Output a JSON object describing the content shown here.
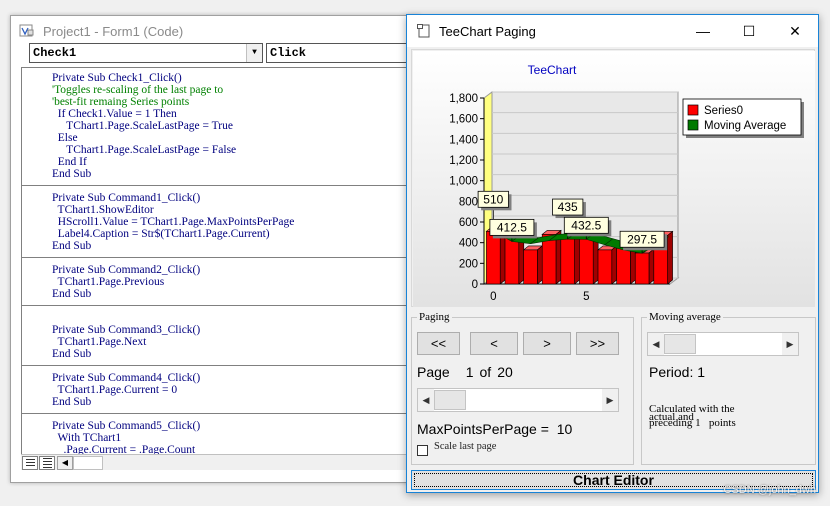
{
  "code_window": {
    "title": "Project1 - Form1 (Code)",
    "object_combo": "Check1",
    "procedure_combo": "Click",
    "lines": [
      {
        "text": "Private Sub Check1_Click()",
        "kind": "code"
      },
      {
        "text": "'Toggles re-scaling of the last page to",
        "kind": "comment"
      },
      {
        "text": "'best-fit remaing Series points",
        "kind": "comment"
      },
      {
        "text": "  If Check1.Value = 1 Then",
        "kind": "code"
      },
      {
        "text": "     TChart1.Page.ScaleLastPage = True",
        "kind": "code"
      },
      {
        "text": "  Else",
        "kind": "code"
      },
      {
        "text": "     TChart1.Page.ScaleLastPage = False",
        "kind": "code"
      },
      {
        "text": "  End If",
        "kind": "code"
      },
      {
        "text": "End Sub",
        "kind": "code"
      },
      {
        "text": "",
        "kind": "sep"
      },
      {
        "text": "Private Sub Command1_Click()",
        "kind": "code"
      },
      {
        "text": "  TChart1.ShowEditor",
        "kind": "code"
      },
      {
        "text": "  HScroll1.Value = TChart1.Page.MaxPointsPerPage",
        "kind": "code"
      },
      {
        "text": "  Label4.Caption = Str$(TChart1.Page.Current)",
        "kind": "code"
      },
      {
        "text": "End Sub",
        "kind": "code"
      },
      {
        "text": "",
        "kind": "sep"
      },
      {
        "text": "Private Sub Command2_Click()",
        "kind": "code"
      },
      {
        "text": "  TChart1.Page.Previous",
        "kind": "code"
      },
      {
        "text": "End Sub",
        "kind": "code"
      },
      {
        "text": "",
        "kind": "sep"
      },
      {
        "text": "",
        "kind": "blank"
      },
      {
        "text": "Private Sub Command3_Click()",
        "kind": "code"
      },
      {
        "text": "  TChart1.Page.Next",
        "kind": "code"
      },
      {
        "text": "End Sub",
        "kind": "code"
      },
      {
        "text": "",
        "kind": "sep"
      },
      {
        "text": "Private Sub Command4_Click()",
        "kind": "code"
      },
      {
        "text": "  TChart1.Page.Current = 0",
        "kind": "code"
      },
      {
        "text": "End Sub",
        "kind": "code"
      },
      {
        "text": "",
        "kind": "sep"
      },
      {
        "text": "Private Sub Command5_Click()",
        "kind": "code"
      },
      {
        "text": "  With TChart1",
        "kind": "code"
      },
      {
        "text": "    .Page.Current = .Page.Count",
        "kind": "code"
      }
    ]
  },
  "tee_window": {
    "title": "TeeChart Paging",
    "min_glyph": "—",
    "max_glyph": "☐",
    "close_glyph": "✕"
  },
  "chart_data": {
    "type": "bar",
    "title": "TeeChart",
    "x": [
      0,
      1,
      2,
      3,
      4,
      5,
      6,
      7,
      8,
      9
    ],
    "series": [
      {
        "name": "Series0",
        "type": "bar",
        "color": "#ff0000",
        "values": [
          510,
          470,
          330,
          480,
          435,
          440,
          330,
          345,
          300,
          470
        ]
      },
      {
        "name": "Moving Average",
        "type": "line",
        "color": "#007a00",
        "values": [
          510,
          412.5,
          390,
          420,
          435,
          432.5,
          380,
          330,
          297.5,
          400
        ]
      }
    ],
    "marks": [
      {
        "text": "510",
        "x": 0
      },
      {
        "text": "412.5",
        "x": 1
      },
      {
        "text": "435",
        "x": 4
      },
      {
        "text": "432.5",
        "x": 5
      },
      {
        "text": "297.5",
        "x": 8
      }
    ],
    "ylim": [
      0,
      1800
    ],
    "y_ticks": [
      0,
      200,
      400,
      600,
      800,
      1000,
      1200,
      1400,
      1600,
      1800
    ],
    "y_tick_labels": [
      "0",
      "200",
      "400",
      "600",
      "800",
      "1,000",
      "1,200",
      "1,400",
      "1,600",
      "1,800"
    ],
    "x_ticks": [
      0,
      5
    ],
    "x_tick_labels": [
      "0",
      "5"
    ],
    "grid": true,
    "legend_position": "top-right",
    "view_3d": true,
    "colors": {
      "title": "#0000c0",
      "wall_left": "#ffff80",
      "back_wall": "#e8e8e8",
      "floor": "#e0e0e0",
      "grid": "#c8c8c8"
    }
  },
  "paging": {
    "group_label": "Paging",
    "btn_first": "<<",
    "btn_prev": "<",
    "btn_next": ">",
    "btn_last": ">>",
    "page_word": "Page",
    "page_current": "1",
    "page_of": "of",
    "page_total": "20",
    "page_scroll_fraction": 0.0,
    "mpp_label": "MaxPointsPerPage =",
    "mpp_value": "10",
    "scale_last_page": "Scale last page",
    "scale_last_page_checked": false
  },
  "moving_average": {
    "group_label": "Moving average",
    "period_label": "Period:",
    "period_value": "1",
    "calc_line1": "Calculated with the",
    "calc_line2": "actual and",
    "calc_line3": "preceding 1   points",
    "period_scroll_fraction": 0.0
  },
  "chart_editor_label": "Chart Editor",
  "watermark": "CSDN @john_dwh"
}
